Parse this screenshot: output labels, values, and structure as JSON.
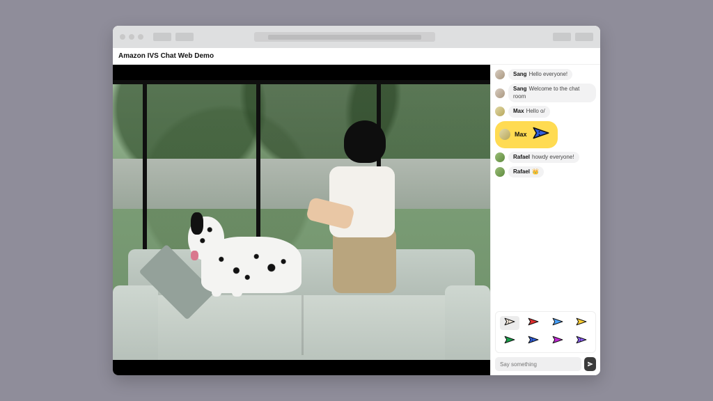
{
  "page_title": "Amazon IVS Chat Web Demo",
  "chat": {
    "messages": [
      {
        "user": "Sang",
        "avatar": "a",
        "text": "Hello everyone!"
      },
      {
        "user": "Sang",
        "avatar": "a",
        "text": "Welcome to the chat room"
      },
      {
        "user": "Max",
        "avatar": "b",
        "text": "Hello o/"
      },
      {
        "user": "Max",
        "avatar": "b",
        "sticker": 5,
        "highlighted": true
      },
      {
        "user": "Rafael",
        "avatar": "c",
        "text": "howdy everyone!"
      },
      {
        "user": "Rafael",
        "avatar": "c",
        "text": "👑"
      }
    ],
    "composer_placeholder": "Say something",
    "stickers": {
      "selected_index": 0,
      "palette": [
        {
          "fill": "#f5e9da",
          "stroke": "#111111",
          "dots": true
        },
        {
          "fill": "#e02f2f",
          "stroke": "#111111",
          "dots": false
        },
        {
          "fill": "#4aa3ff",
          "stroke": "#111111",
          "dots": false
        },
        {
          "fill": "#ffcf33",
          "stroke": "#111111",
          "dots": false
        },
        {
          "fill": "#17a34a",
          "stroke": "#111111",
          "dots": false
        },
        {
          "fill": "#2f5fe0",
          "stroke": "#111111",
          "dots": true
        },
        {
          "fill": "#c026d3",
          "stroke": "#111111",
          "dots": false
        },
        {
          "fill": "#8b5cf6",
          "stroke": "#111111",
          "dots": true
        }
      ]
    }
  }
}
